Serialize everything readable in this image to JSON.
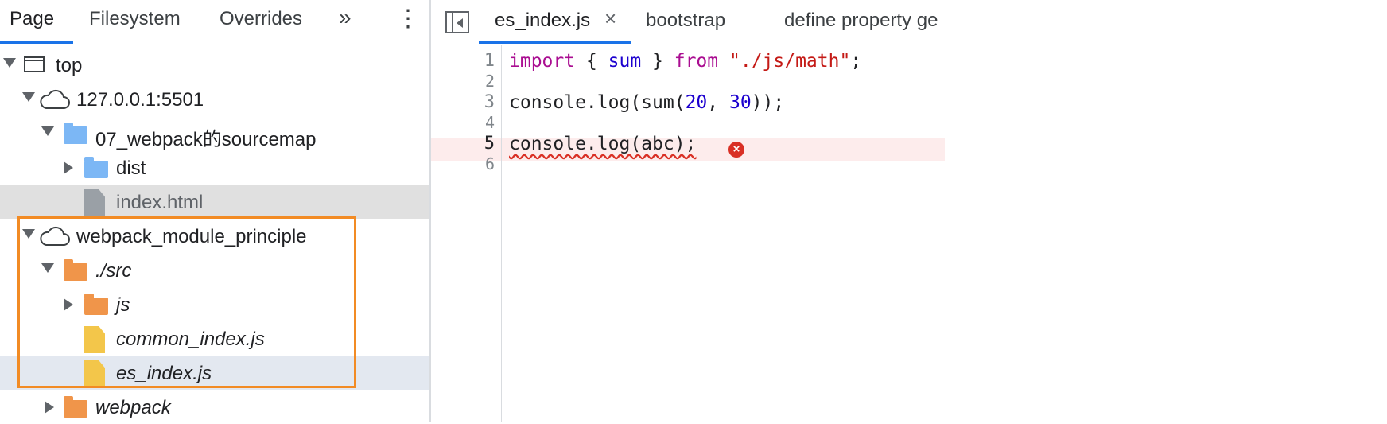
{
  "navigator": {
    "tabs": [
      "Page",
      "Filesystem",
      "Overrides"
    ],
    "more_tabs_glyph": "»",
    "menu_glyph": "⋮",
    "tree": [
      {
        "label": "top",
        "icon": "frame-icon"
      },
      {
        "label": "127.0.0.1:5501",
        "icon": "cloud-icon"
      },
      {
        "label": "07_webpack的sourcemap",
        "icon": "folder-icon"
      },
      {
        "label": "dist",
        "icon": "folder-icon"
      },
      {
        "label": "index.html",
        "icon": "file-icon"
      },
      {
        "label": "webpack_module_principle",
        "icon": "cloud-icon"
      },
      {
        "label": "./src",
        "icon": "folder-icon"
      },
      {
        "label": "js",
        "icon": "folder-icon"
      },
      {
        "label": "common_index.js",
        "icon": "file-icon"
      },
      {
        "label": "es_index.js",
        "icon": "file-icon"
      },
      {
        "label": "webpack",
        "icon": "folder-icon"
      }
    ]
  },
  "editor": {
    "tabs": [
      {
        "label": "es_index.js",
        "closable": true
      },
      {
        "label": "bootstrap"
      },
      {
        "label": "define property ge"
      }
    ],
    "close_glyph": "×",
    "line_numbers": [
      "1",
      "2",
      "3",
      "4",
      "5",
      "6"
    ],
    "code": {
      "l1": {
        "import": "import",
        "open": " { ",
        "sum": "sum",
        "close": " } ",
        "from": "from",
        "sp": " ",
        "path": "\"./js/math\"",
        "semi": ";"
      },
      "l3": {
        "a": "console.log(sum(",
        "n1": "20",
        "comma": ", ",
        "n2": "30",
        "b": "));"
      },
      "l5": {
        "text": "console.log(abc);"
      }
    },
    "error_glyph": "×"
  },
  "colors": {
    "highlight_box": "#f28b24",
    "accent": "#1a73e8",
    "error": "#d93025"
  }
}
